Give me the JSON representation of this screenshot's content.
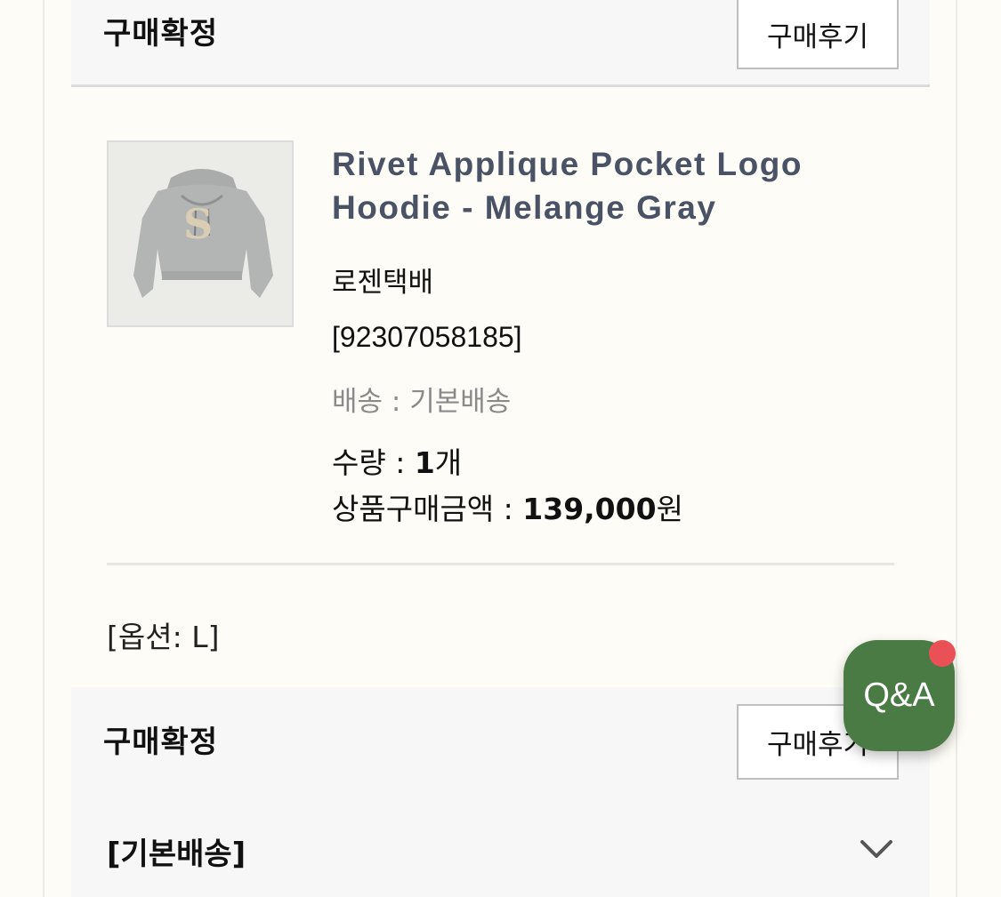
{
  "top_status": {
    "title": "구매확정",
    "review_label": "구매후기"
  },
  "product": {
    "name": "Rivet Applique Pocket Logo Hoodie - Melange Gray",
    "image_letter": "S",
    "courier": "로젠택배",
    "tracking": "[92307058185]",
    "shipping": "배송 : 기본배송",
    "qty_label": "수량 : ",
    "qty_value": "1",
    "qty_unit": "개",
    "price_label": "상품구매금액 : ",
    "price_value": "139,000",
    "price_unit": "원"
  },
  "option": "[옵션: L]",
  "bottom_status": {
    "title": "구매확정",
    "review_label": "구매후기"
  },
  "delivery_type": "[기본배송]",
  "qa": {
    "label": "Q&A"
  },
  "colors": {
    "product_name": "#4a5266",
    "qa_button": "#4a7b44",
    "badge_dot": "#ea5157",
    "panel": "#f7f7f7"
  }
}
